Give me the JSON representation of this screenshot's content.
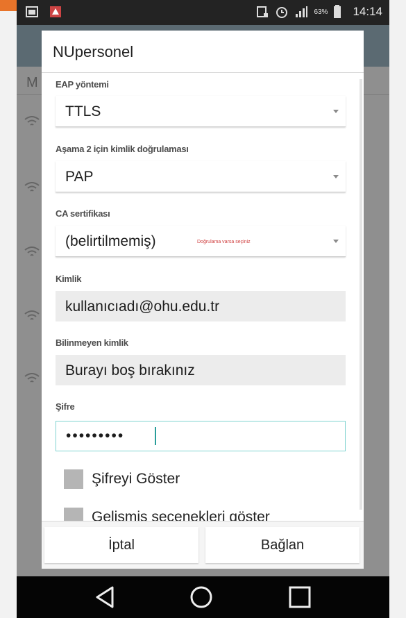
{
  "status_bar": {
    "battery_percent": "63%",
    "time": "14:14"
  },
  "background_app": {
    "partial_letter": "M"
  },
  "dialog": {
    "title": "NUpersonel",
    "eap_method": {
      "label": "EAP yöntemi",
      "value": "TTLS"
    },
    "phase2_auth": {
      "label": "Aşama 2 için kimlik doğrulaması",
      "value": "PAP"
    },
    "ca_certificate": {
      "label": "CA sertifikası",
      "value": "(belirtilmemiş)",
      "hint": "Doğrulama varsa seçiniz"
    },
    "identity": {
      "label": "Kimlik",
      "value": "kullanıcıadı@ohu.edu.tr"
    },
    "anonymous_identity": {
      "label": "Bilinmeyen kimlik",
      "value": "Burayı boş bırakınız"
    },
    "password": {
      "label": "Şifre",
      "value": "•••••••••"
    },
    "show_password": {
      "label": "Şifreyi Göster",
      "checked": false
    },
    "advanced_options": {
      "label": "Gelişmiş seçenekleri göster",
      "checked": false
    },
    "cancel_button": "İptal",
    "connect_button": "Bağlan"
  },
  "colors": {
    "accent": "#2a9d9a",
    "orange": "#e8742a",
    "navbar": "#050505"
  }
}
